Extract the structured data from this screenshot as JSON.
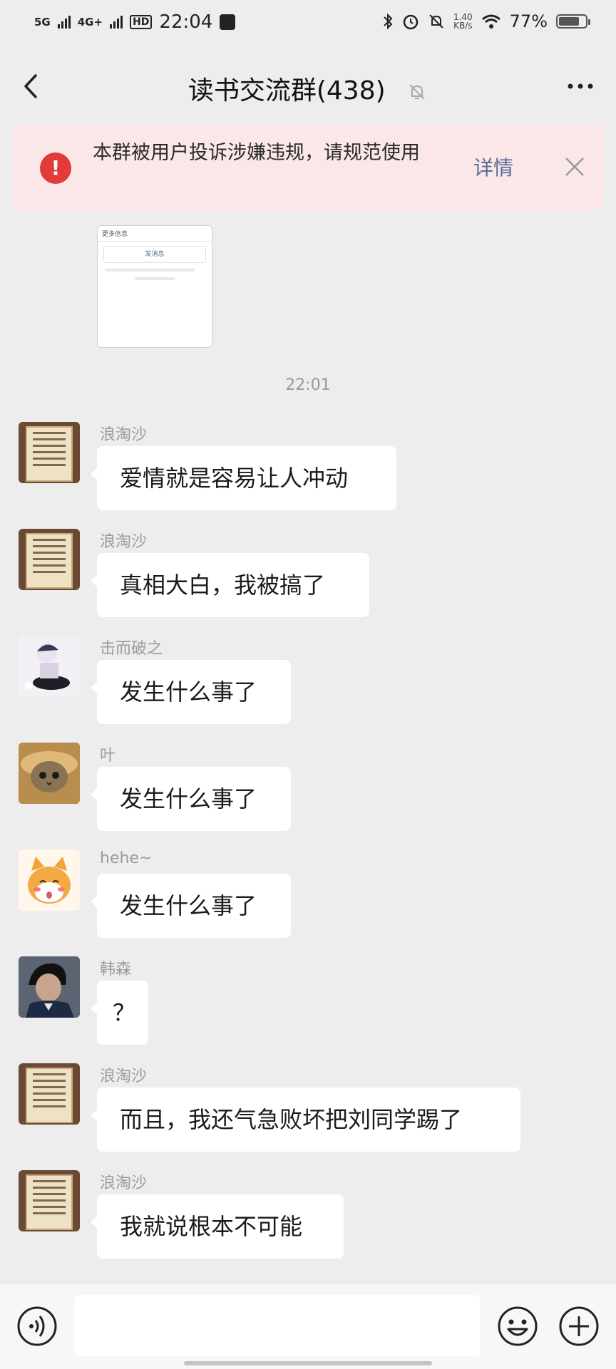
{
  "status_bar": {
    "network_1": "5G",
    "network_2": "4G+",
    "hd": "HD",
    "time": "22:04",
    "net_speed": "1.40",
    "net_speed_unit": "KB/s",
    "battery": "77%",
    "battery_level": 0.77
  },
  "nav": {
    "title": "读书交流群(438)"
  },
  "notice": {
    "icon": "!",
    "text": "本群被用户投诉涉嫌违规，请规范使用",
    "detail_label": "详情"
  },
  "preview_card": {
    "header": "更多信息",
    "button": "发消息"
  },
  "timestamp": "22:01",
  "messages": [
    {
      "sender": "浪淘沙",
      "text": "爱情就是容易让人冲动",
      "avatar": "framed-board-avatar"
    },
    {
      "sender": "浪淘沙",
      "text": "真相大白，我被搞了",
      "avatar": "framed-board-avatar"
    },
    {
      "sender": "击而破之",
      "text": "发生什么事了",
      "avatar": "anime-avatar"
    },
    {
      "sender": "叶",
      "text": "发生什么事了",
      "avatar": "cat-avatar"
    },
    {
      "sender": "hehe~",
      "text": "发生什么事了",
      "avatar": "shiba-avatar"
    },
    {
      "sender": "韩森",
      "text": "？",
      "avatar": "boy-avatar"
    },
    {
      "sender": "浪淘沙",
      "text": "而且，我还气急败坏把刘同学踢了",
      "avatar": "framed-board-avatar"
    },
    {
      "sender": "浪淘沙",
      "text": "我就说根本不可能",
      "avatar": "framed-board-avatar"
    }
  ],
  "input": {
    "value": ""
  },
  "colors": {
    "background": "#ededed",
    "notice_bg": "#fbe7e7",
    "notice_icon": "#e33a3a",
    "link": "#576b95",
    "bubble": "#ffffff"
  }
}
